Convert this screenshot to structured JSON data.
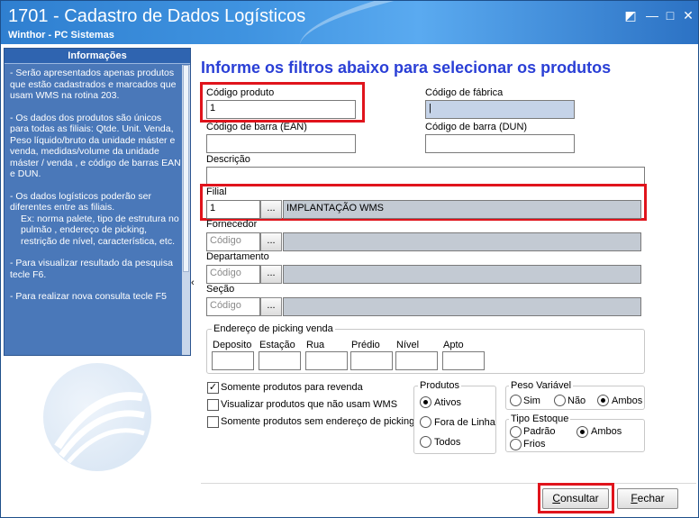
{
  "window": {
    "title": "1701 - Cadastro de Dados Logísticos",
    "subtitle": "Winthor - PC Sistemas",
    "restore_glyph": "◩",
    "minimize_glyph": "—",
    "maximize_glyph": "□",
    "close_glyph": "✕"
  },
  "sidebar": {
    "header": "Informações",
    "collapse_glyph": "‹",
    "paragraphs": [
      "- Serão apresentados apenas produtos que estão cadastrados e marcados que usam WMS na rotina 203.",
      "- Os dados dos produtos são únicos para todas as filiais: Qtde. Unit. Venda, Peso líquido/bruto da unidade máster e venda, medidas/volume da unidade máster / venda , e código de barras EAN e DUN.",
      "- Os dados logísticos poderão ser diferentes entre as filiais.",
      "- Para visualizar resultado da pesquisa tecle F6.",
      "- Para realizar nova consulta tecle F5"
    ],
    "sub_item": "Ex: norma palete, tipo de estrutura no pulmão , endereço de picking, restrição de nível, característica, etc."
  },
  "main": {
    "heading": "Informe os filtros abaixo para selecionar os produtos",
    "codigo_produto": {
      "label": "Código produto",
      "value": "1"
    },
    "codigo_fabrica": {
      "label": "Código de fábrica",
      "value": "|"
    },
    "barra_ean": {
      "label": "Código de barra (EAN)",
      "value": ""
    },
    "barra_dun": {
      "label": "Código de barra (DUN)",
      "value": ""
    },
    "descricao": {
      "label": "Descrição",
      "value": ""
    },
    "filial": {
      "label": "Filial",
      "value": "1",
      "name": "IMPLANTAÇÃO WMS"
    },
    "fornecedor": {
      "label": "Fornecedor",
      "placeholder": "Código",
      "name": ""
    },
    "departamento": {
      "label": "Departamento",
      "placeholder": "Código",
      "name": ""
    },
    "secao": {
      "label": "Seção",
      "placeholder": "Código",
      "name": ""
    },
    "lookup_label": "...",
    "picking": {
      "title": "Endereço de picking venda",
      "fields": [
        "Deposito",
        "Estação",
        "Rua",
        "Prédio",
        "Nível",
        "Apto"
      ]
    },
    "checkboxes": [
      {
        "label": "Somente produtos para revenda",
        "checked": true,
        "mark": "✓"
      },
      {
        "label": "Visualizar produtos que não usam WMS",
        "checked": false,
        "mark": ""
      },
      {
        "label": "Somente produtos sem endereço de picking",
        "checked": false,
        "mark": ""
      }
    ],
    "produtos": {
      "title": "Produtos",
      "options": [
        "Ativos",
        "Fora de Linha",
        "Todos"
      ],
      "selected": "Ativos"
    },
    "peso_variavel": {
      "title": "Peso Variável",
      "options": [
        "Sim",
        "Não",
        "Ambos"
      ],
      "selected": "Ambos"
    },
    "tipo_estoque": {
      "title": "Tipo Estoque",
      "options": [
        "Padrão",
        "Ambos",
        "Frios"
      ],
      "selected": "Ambos"
    },
    "buttons": {
      "consultar_hotkey": "C",
      "consultar_rest": "onsultar",
      "fechar_hotkey": "F",
      "fechar_rest": "echar"
    }
  },
  "colors": {
    "highlight": "#e0141c",
    "heading": "#2a3fd6",
    "sidebar_bg": "#4a78b9"
  }
}
